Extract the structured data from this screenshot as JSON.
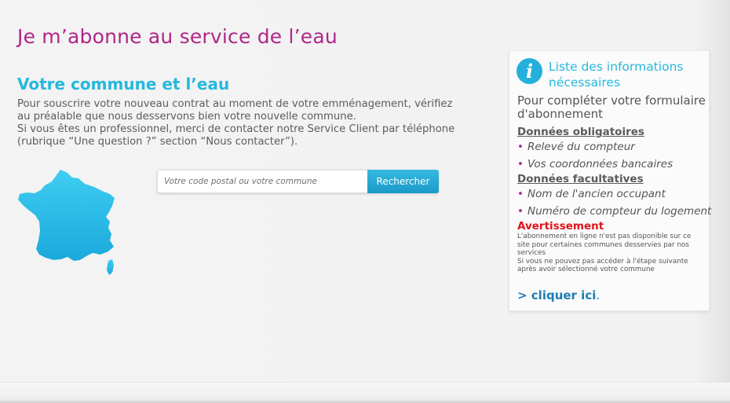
{
  "page_title": "Je m’abonne au service de l’eau",
  "section": {
    "title": "Votre commune et l’eau",
    "paragraph1": "Pour souscrire votre nouveau contrat au moment de votre emménagement, vérifiez au préalable que nous desservons bien votre nouvelle commune.",
    "paragraph2": "Si vous êtes un professionnel, merci de contacter notre Service Client par téléphone (rubrique “Une question ?” section “Nous contacter”)."
  },
  "search": {
    "placeholder": "Votre code postal ou votre commune",
    "button_label": "Rechercher"
  },
  "info_panel": {
    "icon_letter": "i",
    "title": "Liste des informations nécessaires",
    "subtitle": "Pour compléter votre formulaire d'abonnement",
    "mandatory_heading": "Données obligatoires",
    "mandatory_items": [
      "Relevé du compteur",
      "Vos coordonnées bancaires"
    ],
    "optional_heading": "Données facultatives",
    "optional_items": [
      "Nom de l'ancien occupant",
      "Numéro de compteur du logement"
    ],
    "warning_title": "Avertissement",
    "warning_line1": "L'abonnement en ligne n'est pas disponible sur ce site pour certaines communes desservies par nos services",
    "warning_line2": "Si vous ne pouvez pas accéder à l'étape suivante après avoir sélectionné votre commune",
    "link_label": "> cliquer ici",
    "link_suffix": "."
  },
  "icons": {
    "info": "info-icon",
    "map": "france-map-icon"
  },
  "colors": {
    "title_magenta": "#b0268a",
    "accent_cyan": "#25b8de",
    "button_blue": "#1a9ac8",
    "warning_red": "#e0141a",
    "link_blue": "#1a7db5"
  }
}
